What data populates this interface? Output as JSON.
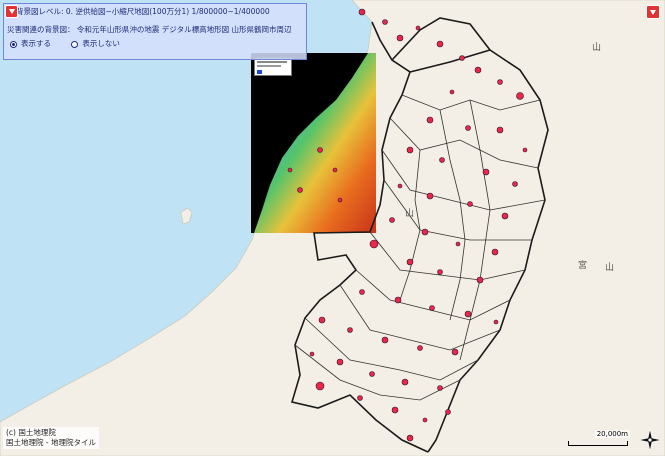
{
  "panel": {
    "level_text": "背景図レベル: 0.   逆供給図~小縮尺地図(100万分1)        1/800000~1/400000",
    "layer_text": "災害関連の背景図： 令和元年山形県沖の地震 デジタル標高地形図 山形県鶴岡市周辺",
    "show_label": "表示する",
    "hide_label": "表示しない"
  },
  "attribution": {
    "line1": "(c) 国土地理院",
    "line2": "国土地理院 - 地理院タイル"
  },
  "scale": {
    "label": "20,000m"
  },
  "map_labels": {
    "mountain1": "山",
    "mountain2": "山",
    "mountain3": "山",
    "place1": "宮"
  },
  "colors": {
    "sea": "#bfe3f4",
    "land": "#f3efe6",
    "boundary": "#222222",
    "landslide": "#e8274b",
    "panel": "#d6e0fc",
    "button": "#e23333"
  },
  "icons": {
    "menu": "chevron-down-icon",
    "panel_toggle": "chevron-down-icon",
    "compass": "compass-icon"
  }
}
